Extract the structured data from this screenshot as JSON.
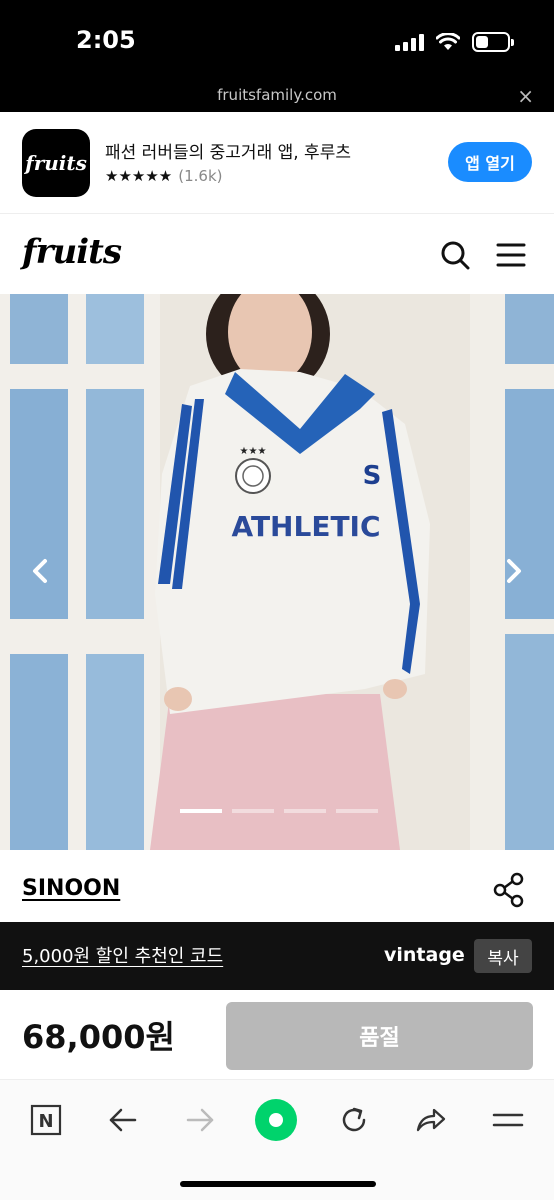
{
  "status_bar": {
    "time": "2:05",
    "battery_level": 0.3
  },
  "url_bar": {
    "url": "fruitsfamily.com",
    "close_icon": "close-icon"
  },
  "app_banner": {
    "logo_text": "fruits",
    "title": "패션 러버들의 중고거래 앱, 후루츠",
    "stars": "★★★★★",
    "rating_count": "(1.6k)",
    "open_label": "앱 열기",
    "accent_color": "#1a8cff"
  },
  "header": {
    "logo_text": "fruits",
    "search_icon": "search-icon",
    "menu_icon": "menu-icon"
  },
  "product_image": {
    "jersey_text": "ATHLETIC",
    "jersey_stars": "★★★",
    "jersey_logo": "S",
    "slide_count": 4,
    "active_slide": 1
  },
  "product": {
    "brand": "SINOON",
    "share_icon": "share-icon"
  },
  "promo": {
    "text": "5,000원 할인 추천인 코드",
    "code": "vintage",
    "copy_label": "복사"
  },
  "purchase": {
    "price": "68,000원",
    "button_label": "품절"
  },
  "toolbar": {
    "items": [
      "naver-icon",
      "back-arrow-icon",
      "forward-arrow-icon",
      "green-dot-icon",
      "refresh-icon",
      "share-arrow-icon",
      "menu-lines-icon"
    ],
    "naver_letter": "N",
    "accent_color": "#00d36c"
  }
}
